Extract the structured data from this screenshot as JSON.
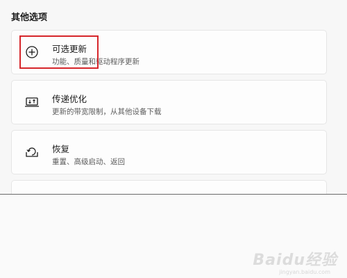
{
  "section": {
    "title": "其他选项"
  },
  "cards": [
    {
      "title": "可选更新",
      "subtitle": "功能、质量和驱动程序更新",
      "icon": "plus-circle-icon"
    },
    {
      "title": "传递优化",
      "subtitle": "更新的带宽限制，从其他设备下载",
      "icon": "delivery-optimization-icon"
    },
    {
      "title": "恢复",
      "subtitle": "重置、高级启动、返回",
      "icon": "recovery-icon"
    }
  ],
  "watermark": {
    "brand": "Baidu经验",
    "url": "jingyan.baidu.com"
  },
  "colors": {
    "highlight": "#d6262b",
    "card_bg": "#fdfdfd",
    "page_bg": "#f7f7f7"
  }
}
